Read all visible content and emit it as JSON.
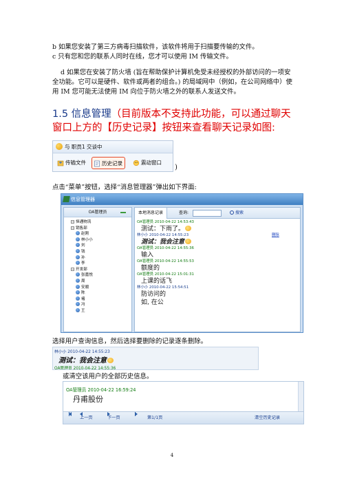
{
  "intro": {
    "line_b": "b 如果您安装了第三方病毒扫描软件，该软件将用于扫描要传输的文件。",
    "line_c": "c 只有您和您的联系人同时在线，您才可以使用 IM 传输文件。",
    "line_d": "d 如果您在安装了防火墙 (旨在帮助保护计算机免受未经授权的外部访问的一项安全功能。它可以是硬件、软件或两者的组合。) 的局域网中（例如，在公司网络中）使用 IM 您可能无法使用 IM 向位于防火墙之外的联系人发送文件。"
  },
  "section": {
    "number": "1.5 信息管理",
    "highlight": "（目前版本不支持此功能，可以通过聊天窗口上方的【历史记录】按钮来查看聊天记录如图:"
  },
  "toolbar_shot": {
    "chat_title": "与  职员1  交谈中",
    "btn_transfer": "传输文件",
    "btn_history": "历史记录",
    "btn_shake": "震动窗口",
    "close_paren": ")"
  },
  "caption_menu": "点击“菜单”按钮，选择“消息管理器”弹出如下界面:",
  "msg_window": {
    "title": "信息管理器",
    "left_header": "OA管理员",
    "tree": [
      {
        "kind": "node",
        "label": "恒通物流"
      },
      {
        "kind": "node",
        "label": "销售部"
      },
      {
        "kind": "user",
        "label": "赵刚"
      },
      {
        "kind": "user",
        "label": "林小小"
      },
      {
        "kind": "user",
        "label": "刘"
      },
      {
        "kind": "user",
        "label": "钱"
      },
      {
        "kind": "user",
        "label": "孙"
      },
      {
        "kind": "user",
        "label": "李"
      },
      {
        "kind": "node",
        "label": "开发部"
      },
      {
        "kind": "user",
        "label": "张嘉悦"
      },
      {
        "kind": "user",
        "label": "周"
      },
      {
        "kind": "user",
        "label": "安顺"
      },
      {
        "kind": "user",
        "label": "陈"
      },
      {
        "kind": "user",
        "label": "褚"
      },
      {
        "kind": "user",
        "label": "冯"
      },
      {
        "kind": "user",
        "label": "王"
      }
    ],
    "tab_local": "本地消息记录",
    "query_label": "查询:",
    "search_btn": "搜索",
    "delete_label": "删除",
    "messages": [
      {
        "sender": "OA管理员 2010-04-22 14:53:43",
        "self": true,
        "text": "测试：下雨了。",
        "bold": false
      },
      {
        "sender": "林小小 2010-04-22 14:55:23",
        "self": false,
        "text": "测试：我会注意",
        "bold": true
      },
      {
        "sender": "OA管理员 2010-04-22 14:55:36",
        "self": true,
        "text": "输入",
        "bold": false
      },
      {
        "sender": "OA管理员 2010-04-22 14:55:53",
        "self": true,
        "text": "额度的",
        "bold": false
      },
      {
        "sender": "OA管理员 2010-04-22 15:01:31",
        "self": true,
        "text": "上课的话飞",
        "bold": false
      },
      {
        "sender": "林小小 2010-04-22 15:54:51",
        "self": false,
        "text": "",
        "bold": false
      },
      {
        "sender": "",
        "self": true,
        "text": "防访问的",
        "bold": false
      },
      {
        "sender": "",
        "self": true,
        "text": "如, 在公",
        "bold": false
      }
    ]
  },
  "caption_select": "选择用户查询信息，然后选择要删除的记录逐条删除。",
  "select_shot": {
    "meta1": "林小小 2010-04-22 14:55:23",
    "text": "测试：我会注意",
    "meta2": "OA管理员 2010-04-22 14:55:36"
  },
  "caption_clear": "或清空该用户的全部历史信息。",
  "clear_shot": {
    "meta": "OA管理员 2010-04-22 16:59:24",
    "text": "丹甫股份",
    "prev": "上一页",
    "next": "下一页",
    "page": "第1/1页",
    "clear_btn": "清空历史记录"
  },
  "page_number": "4"
}
